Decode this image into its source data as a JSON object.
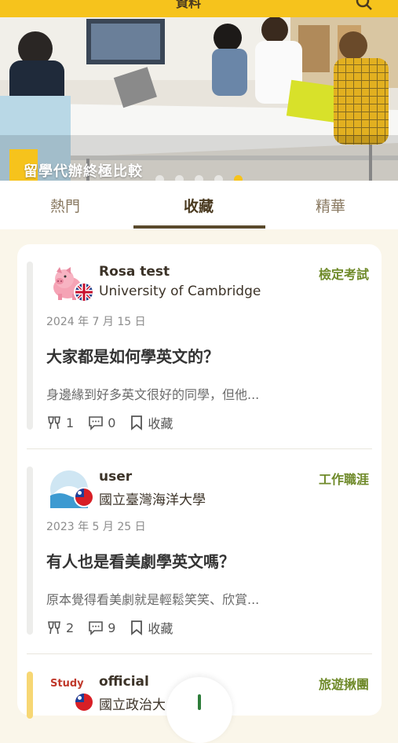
{
  "topbar": {
    "title": "資料",
    "search_icon": "search-icon"
  },
  "banner": {
    "caption": "留學代辦終極比較",
    "slide_count": 5,
    "active_slide": 5
  },
  "tabs": [
    {
      "label": "熱門",
      "active": false
    },
    {
      "label": "收藏",
      "active": true
    },
    {
      "label": "精華",
      "active": false
    }
  ],
  "posts": [
    {
      "username": "Rosa test",
      "school": "University of Cambridge",
      "avatar_icon": "pig-avatar",
      "flag_icon": "uk-flag-icon",
      "category": "檢定考試",
      "date": "2024 年 7 月 15 日",
      "title": "大家都是如何學英文的？",
      "excerpt": "身邊緣到好多英文很好的同學，但他...",
      "cheers": "1",
      "comments": "0",
      "bookmark_label": "收藏"
    },
    {
      "username": "user",
      "school": "國立臺灣海洋大學",
      "avatar_icon": "sea-avatar",
      "flag_icon": "taiwan-flag-icon",
      "category": "工作職涯",
      "date": "2023 年 5 月 25 日",
      "title": "有人也是看美劇學英文嗎？",
      "excerpt": "原本覺得看美劇就是輕鬆笑笑、欣賞...",
      "cheers": "2",
      "comments": "9",
      "bookmark_label": "收藏"
    },
    {
      "username": "official",
      "school": "國立政治大",
      "avatar_icon": "study-logo-avatar",
      "avatar_text": "Study",
      "flag_icon": "taiwan-flag-icon",
      "category": "旅遊揪團"
    }
  ],
  "colors": {
    "accent": "#f6c31c",
    "category": "#6f8a2a",
    "tab_active": "#4a3a20"
  }
}
